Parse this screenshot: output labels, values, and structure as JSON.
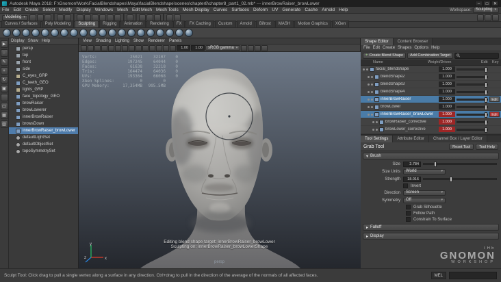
{
  "colors": {
    "accent_blue": "#4f7cab",
    "edit_red": "#b13030",
    "value_red": "#9e2626",
    "viewport_top": "#6e7988",
    "viewport_bottom": "#24272d"
  },
  "title_bar": {
    "title": "Autodesk Maya 2018: F:\\Gnomon\\Work\\FacialBlendshapes\\Maya\\facialBlendshape\\scenes\\chapter8\\chapter8_part1_02.mb* --- innerBrowRaiser_browLower",
    "window_buttons": [
      "–",
      "□",
      "✕"
    ]
  },
  "menu_bar": {
    "items": [
      "File",
      "Edit",
      "Create",
      "Select",
      "Modify",
      "Display",
      "Windows",
      "Mesh",
      "Edit Mesh",
      "Mesh Tools",
      "Mesh Display",
      "Curves",
      "Surfaces",
      "Deform",
      "UV",
      "Generate",
      "Cache",
      "Arnold",
      "Help"
    ],
    "workspace_label": "Workspace:",
    "workspace_value": "Sculpting"
  },
  "status_line": {
    "menuset_value": "Modeling",
    "icons": [
      "new-scene-icon",
      "open-scene-icon",
      "save-scene-icon",
      "divider",
      "undo-icon",
      "redo-icon",
      "divider",
      "snap-to-grid-icon",
      "snap-to-curve-icon",
      "snap-to-point-icon",
      "snap-to-projected-center-icon",
      "snap-to-view-plane-icon",
      "make-live-icon",
      "divider",
      "construction-history-icon",
      "divider",
      "render-icon",
      "ipr-render-icon",
      "render-settings-icon",
      "divider",
      "paint-effects-icon",
      "hypershade-icon"
    ],
    "right_icons": [
      "attribute-editor-toggle-icon",
      "tool-settings-toggle-icon",
      "channel-box-toggle-icon"
    ]
  },
  "shelf": {
    "tabs": [
      {
        "label": "Curves / Surfaces"
      },
      {
        "label": "Poly Modeling"
      },
      {
        "label": "Sculpting",
        "cls": "active"
      },
      {
        "label": "Rigging"
      },
      {
        "label": "Animation"
      },
      {
        "label": "Rendering"
      },
      {
        "label": "FX"
      },
      {
        "label": "FX Caching"
      },
      {
        "label": "Custom"
      },
      {
        "label": "Arnold"
      },
      {
        "label": "Bifrost"
      },
      {
        "label": "MASH"
      },
      {
        "label": "Motion Graphics"
      },
      {
        "label": "XGen"
      }
    ],
    "icons": [
      "sculpt-tool-icon",
      "smooth-tool-icon",
      "relax-tool-icon",
      "grab-tool-icon",
      "pinch-tool-icon",
      "flatten-tool-icon",
      "foamy-tool-icon",
      "spray-tool-icon",
      "repeat-tool-icon",
      "imprint-tool-icon",
      "wax-tool-icon",
      "scrape-tool-icon",
      "fill-tool-icon",
      "knife-tool-icon",
      "smear-tool-icon",
      "bulge-tool-icon",
      "amplify-tool-icon",
      "freeze-tool-icon",
      "unfreeze-tool-icon",
      "convert-to-frozen-icon"
    ]
  },
  "toolbox": {
    "tools": [
      {
        "icon": "select-tool-icon",
        "g": "▶"
      },
      {
        "icon": "lasso-tool-icon",
        "g": "◌"
      },
      {
        "icon": "paint-select-tool-icon",
        "g": "✎"
      },
      {
        "icon": "move-tool-icon",
        "g": "+"
      },
      {
        "icon": "rotate-tool-icon",
        "g": "↻"
      },
      {
        "icon": "scale-tool-icon",
        "g": "▣"
      },
      {
        "icon": "last-tool-icon",
        "g": ""
      },
      {
        "icon": "single-pane-layout-icon",
        "g": "▢"
      },
      {
        "icon": "four-pane-layout-icon",
        "g": "▦"
      },
      {
        "icon": "persp-outliner-layout-icon",
        "g": "▥"
      }
    ]
  },
  "outliner": {
    "menus": [
      "Display",
      "Show",
      "Help"
    ],
    "items": [
      {
        "label": "persp",
        "icon": "camera-icon"
      },
      {
        "label": "top",
        "icon": "camera-icon"
      },
      {
        "label": "front",
        "icon": "camera-icon"
      },
      {
        "label": "side",
        "icon": "camera-icon"
      },
      {
        "label": "C_eyes_GRP",
        "icon": "group-icon"
      },
      {
        "label": "C_teeth_GEO",
        "icon": "mesh-icon"
      },
      {
        "label": "lights_GRP",
        "icon": "group-icon"
      },
      {
        "label": "face_topology_GEO",
        "icon": "mesh-icon"
      },
      {
        "label": "browRaiser",
        "icon": "mesh-icon"
      },
      {
        "label": "browLowerer",
        "icon": "mesh-icon"
      },
      {
        "label": "innerBrowRaiser",
        "icon": "mesh-icon"
      },
      {
        "label": "browsDown",
        "icon": "mesh-icon"
      },
      {
        "label": "innerBrowRaiser_browLower",
        "icon": "mesh-icon",
        "cls": "selected"
      },
      {
        "label": "defaultLightSet",
        "icon": "set-icon"
      },
      {
        "label": "defaultObjectSet",
        "icon": "set-icon"
      },
      {
        "label": "topoSymmetrySet",
        "icon": "set-icon"
      }
    ]
  },
  "viewport": {
    "menus": [
      "View",
      "Shading",
      "Lighting",
      "Show",
      "Renderer",
      "Panels"
    ],
    "toolbar_icons_left": [
      "select-camera-icon",
      "lock-camera-icon",
      "camera-attributes-icon",
      "bookmark-icon",
      "image-plane-icon",
      "2d-pan-zoom-icon",
      "grease-pencil-icon",
      "grid-icon",
      "film-gate-icon",
      "resolution-gate-icon",
      "gate-mask-icon",
      "field-chart-icon",
      "safe-action-icon",
      "safe-title-icon"
    ],
    "exposure_value": "1.00",
    "gamma_value": "1.00",
    "view_transform": "sRGB gamma",
    "toolbar_icons_right": [
      "xray-icon",
      "wireframe-on-shaded-icon",
      "default-material-icon",
      "isolate-select-icon"
    ],
    "hud": {
      "rows": [
        {
          "l": "Verts:",
          "a": "25021",
          "b": "32107",
          "c": "0"
        },
        {
          "l": "Edges:",
          "a": "197245",
          "b": "64044",
          "c": "0"
        },
        {
          "l": "Faces:",
          "a": "61638",
          "b": "32218",
          "c": "0"
        },
        {
          "l": "Tris:",
          "a": "164474",
          "b": "64036",
          "c": "0"
        },
        {
          "l": "UVs:",
          "a": "193364",
          "b": "66068",
          "c": "0"
        },
        {
          "l": "XGen Splines:",
          "a": "0",
          "b": "0",
          "c": ""
        },
        {
          "l": "GPU Memory:",
          "a": "17,354MB",
          "b": "995.5MB",
          "c": ""
        }
      ]
    },
    "messages": [
      "Editing blend shape target: innerBrowRaiser_browLower",
      "Sculpting on: innerBrowRaiser_browLowerShape"
    ],
    "camera_label": "persp",
    "axis": {
      "x": "x",
      "y": "y",
      "z": "z"
    }
  },
  "shape_editor": {
    "tabs": [
      {
        "label": "Shape Editor",
        "cls": "active"
      },
      {
        "label": "Content Browser"
      }
    ],
    "menus": [
      "File",
      "Edit",
      "Create",
      "Shapes",
      "Options",
      "Help"
    ],
    "create_blend_shape_label": "Create Blend Shape",
    "add_combination_label": "Add Combination Target",
    "header": {
      "name": "Name",
      "weight": "Weight/Driven",
      "edit": "Edit",
      "key": "Key"
    },
    "rows": [
      {
        "label": "facial_blendshape",
        "value": "1.000",
        "edit": "",
        "indent": 0
      },
      {
        "label": "blendShape2",
        "value": "1.000",
        "edit": "",
        "indent": 1
      },
      {
        "label": "blendShape3",
        "value": "1.000",
        "edit": "",
        "indent": 1
      },
      {
        "label": "blendShape4",
        "value": "1.000",
        "edit": "",
        "indent": 1
      },
      {
        "label": "innerBrowRaiser",
        "value": "1.000",
        "edit": "Edit",
        "indent": 1,
        "cls": "selected"
      },
      {
        "label": "browLower",
        "value": "1.000",
        "edit": "",
        "indent": 1
      },
      {
        "label": "innerBrowRaiser_browLower",
        "value": "1.000",
        "edit": "Edit",
        "indent": 1,
        "cls": "selected red edit-red"
      },
      {
        "label": "browRaiser_corrective",
        "value": "1.000",
        "edit": "",
        "indent": 2,
        "cls": "red"
      },
      {
        "label": "browLower_corrective",
        "value": "1.000",
        "edit": "",
        "indent": 2,
        "cls": "red"
      }
    ]
  },
  "tool_settings": {
    "tabs": [
      {
        "label": "Tool Settings",
        "cls": "active"
      },
      {
        "label": "Attribute Editor"
      },
      {
        "label": "Channel Box / Layer Editor"
      }
    ],
    "tool_name": "Grab Tool",
    "reset_label": "Reset Tool",
    "help_label": "Tool Help",
    "brush_section": "Brush",
    "size_label": "Size",
    "size_value": "2.784",
    "size_units_label": "Size Units",
    "size_units_value": "World",
    "strength_label": "Strength",
    "strength_value": "18.016",
    "invert_label": "Invert",
    "direction_label": "Direction",
    "direction_value": "Screen",
    "symmetry_label": "Symmetry",
    "symmetry_value": "Off",
    "checkboxes": [
      "Grab Silhouette",
      "Follow Path",
      "Constrain To Surface"
    ],
    "falloff_section": "Falloff",
    "display_section": "Display"
  },
  "bottom_bar": {
    "help_text": "Sculpt Tool: Click drag to pull a single vertex along a surface in any direction. Ctrl+drag to pull in the direction of the average of the normals of all affected faces.",
    "command_label": "MEL"
  },
  "watermark": {
    "the": "THE",
    "gnomon": "GNOMON",
    "workshop": "WORKSHOP"
  }
}
